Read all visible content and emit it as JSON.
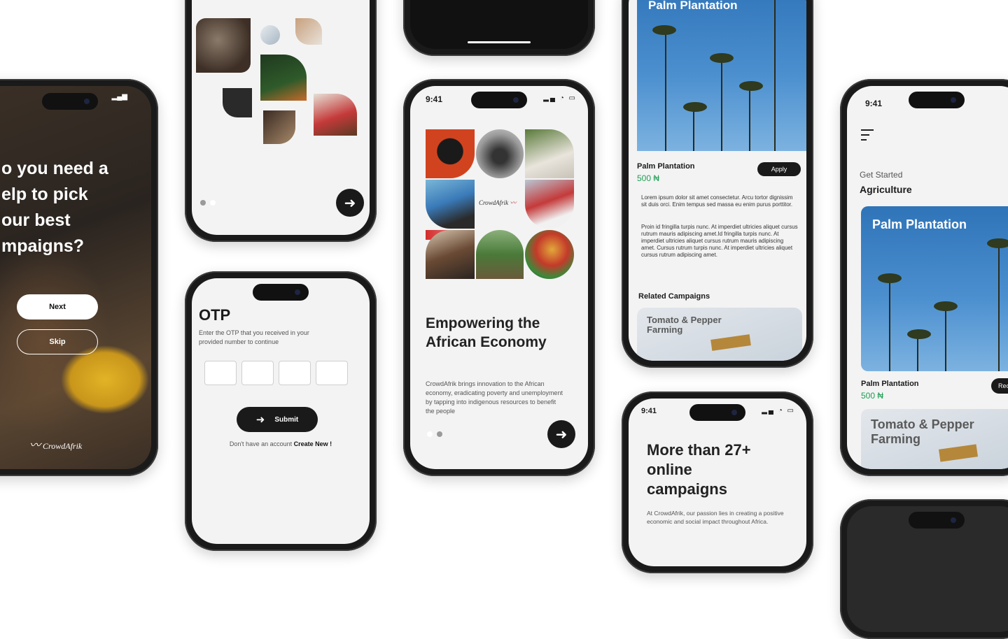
{
  "onboarding": {
    "question": [
      "o you need a",
      "elp to pick",
      "our best",
      "mpaigns?"
    ],
    "next_label": "Next",
    "skip_label": "Skip",
    "logo_text": "CrowdAfrik"
  },
  "otp": {
    "title": "OTP",
    "subtitle": "Enter the OTP that you received in your provided number to continue",
    "submit_label": "Submit",
    "no_account_text": "Don't have an account",
    "create_label": "Create New !"
  },
  "intro": {
    "time": "9:41",
    "heading": "Empowering the African Economy",
    "body": "CrowdAfrik brings innovation to the African economy, eradicating poverty and unemployment by tapping into indigenous resources to benefit the people",
    "logo_text": "CrowdAfrik"
  },
  "detail": {
    "hero_title": "Palm Plantation",
    "name": "Palm Plantation",
    "price": "500 ₦",
    "apply_label": "Apply",
    "para1": "Lorem ipsum dolor sit amet consectetur. Arcu tortor dignissim sit duis orci. Enim tempus sed massa eu enim purus porttitor.",
    "para2": "Proin id fringilla turpis nunc. At imperdiet ultricies aliquet cursus rutrum mauris adipiscing amet.Id fringilla turpis nunc. At imperdiet ultricies aliquet cursus rutrum mauris adipiscing amet. Cursus rutrum turpis nunc. At imperdiet ultricies aliquet cursus rutrum adipiscing amet.",
    "related_title": "Related Campaigns",
    "related_card": "Tomato & Pepper Farming"
  },
  "campaigns": {
    "time": "9:41",
    "heading": "More than 27+ online campaigns",
    "body": "At CrowdAfrik, our passion lies in creating a positive economic and social impact throughout Africa."
  },
  "category": {
    "time": "9:41",
    "get_started": "Get Started",
    "category_title": "Agriculture",
    "card_title": "Palm Plantation",
    "name": "Palm Plantation",
    "price": "500 ₦",
    "button_label": "Rec",
    "card2_title": "Tomato & Pepper Farming"
  },
  "colors": {
    "accent_green": "#1f9d55",
    "dark": "#1a1a1a",
    "screen_bg": "#f3f3f3"
  }
}
